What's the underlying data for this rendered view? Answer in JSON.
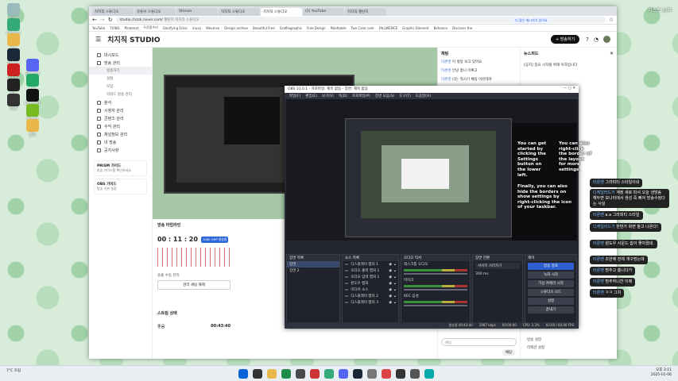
{
  "desktop": {
    "icons": [
      "휴지통",
      "Chrome",
      "폴더",
      "Steam",
      "Adobe",
      "Rix",
      "OBS",
      "Discord",
      "한컴",
      "ChatGPT",
      "Nvidia",
      "폴더"
    ],
    "top_right_text": "지스트 W다"
  },
  "browser": {
    "tabs": [
      "치지직 스튜디오",
      "유튜브 스튜디오",
      "Stream",
      "치지직 스튜디오",
      "치지직 스튜디오",
      "(1) YouTube",
      "치지직 챌린지"
    ],
    "url": "studio.chzzk.naver.com/",
    "url_suffix": "챌린지 치지직 스튜디오",
    "bookmarks": [
      "YouTube",
      "TVING",
      "Pinterest",
      "두루뭉수리",
      "Glorifying Eclec",
      "muxy",
      "Weverse",
      "Design archive",
      "Beautiful Free",
      "Grafilographic",
      "Free Design",
      "Palettable",
      "Two Color com",
      "FALLWENCE",
      "Graphic Element",
      "Behance",
      "Discover the"
    ],
    "logo": "치지직 STUDIO",
    "live_button": "+ 방송하기",
    "sidebar": [
      {
        "label": "대시보드",
        "sub": false
      },
      {
        "label": "방송 관리",
        "sub": false
      },
      {
        "label": "방송하기",
        "sub": true,
        "selected": true
      },
      {
        "label": "설정",
        "sub": true
      },
      {
        "label": "모임",
        "sub": true
      },
      {
        "label": "리워드 방송 관리",
        "sub": true
      },
      {
        "label": "분석",
        "sub": false
      },
      {
        "label": "시청자 관리",
        "sub": false
      },
      {
        "label": "콘텐츠 관리",
        "sub": false
      },
      {
        "label": "수익 관리",
        "sub": false
      },
      {
        "label": "채널정보 관리",
        "sub": false
      },
      {
        "label": "내 방송",
        "sub": false
      },
      {
        "label": "공지사항",
        "sub": false
      }
    ],
    "promo": [
      {
        "title": "PRISM 가이드",
        "desc": "방송 가이드를 확인하세요"
      },
      {
        "title": "OBS 가이드",
        "desc": "방송 기본 설정"
      }
    ],
    "timer_label": "방송 타임라인",
    "timer": "00 : 11 : 20",
    "timer_badge": "1080 DRP 방송중",
    "stream_status_label": "스트림 상태",
    "stream_status_value": "좋음",
    "stream_time": "00:43:40",
    "bitrate_label": "송출 수동 관리",
    "bitrate_button": "관리 세팅 해제",
    "chat_header": "채팅",
    "chat": [
      {
        "name": "타룬멘",
        "text": "이 생방 보고 있어요"
      },
      {
        "name": "타룬멘",
        "text": "안녕 흠니 이쁘고"
      },
      {
        "name": "타룬멘",
        "text": "너는 뭐시기 채팅 이런데야"
      }
    ],
    "news_header": "뉴스피드",
    "news_text": "[공지] 중요 시작될 위해 이하입니다",
    "news_badge": "더 많은 메시지가 있어요",
    "chat_input_label": "채팅",
    "chat_send": "채팅",
    "bottom_notes": [
      "방송 설정",
      "리액션 설정"
    ]
  },
  "obs": {
    "title": "OBS 31.0.1 - 프로파일: 제목 없음 - 장면: 제목 없음",
    "menu": [
      "파일(F)",
      "편집(E)",
      "보기(V)",
      "독(D)",
      "프로파일(P)",
      "장면 모음(S)",
      "도구(T)",
      "도움말(H)"
    ],
    "scene_header": "장면 목록",
    "scenes": [
      "장면",
      "장면 2"
    ],
    "source_header": "소스 목록",
    "sources": [
      "디스플레이 캡처 1",
      "오디오 출력 캡처 1",
      "오디오 입력 캡처 1",
      "윈도우 캡처",
      "미디어 소스",
      "디스플레이 캡처 2",
      "디스플레이 캡처 3"
    ],
    "mixer_header": "오디오 믹서",
    "mixer": [
      "데스크톱 오디오",
      "마이크",
      "REC 음성"
    ],
    "transition_header": "장면 전환",
    "transition_value": "서서히 사라지기",
    "transition_duration": "300 ms",
    "controls_header": "제어",
    "controls": [
      "방송 종료",
      "녹화 시작",
      "가상 카메라 시작",
      "스튜디오 모드",
      "설정",
      "끝내기"
    ],
    "status": [
      "방송중 00:43:40",
      "2987 kbps",
      "00:00:00",
      "CPU: 3.3%",
      "60.00 / 60.00 FPS"
    ]
  },
  "callouts": [
    "You can get started by clicking the Settings button on the lower left.",
    "You can also right-click the border of the layout for more settings.",
    "Finally, you can also hide the borders on show settings by right-clicking the icon of your taskbar."
  ],
  "chat_overlay": [
    {
      "name": "타룬멘",
      "text": "그라피티 스타일이네"
    },
    {
      "name": "디케일러드거",
      "text": "계정 새로 파서 오늘 생방송 해두면 모니터에서 생성 죽 빠져 방송수정다는 사실"
    },
    {
      "name": "타룬멘",
      "text": "a.a 그라피티 스타일"
    },
    {
      "name": "디케일러드거",
      "text": "한번가 화면 돌고 나온다!"
    },
    {
      "name": "타룬멘",
      "text": "윈도우 사운드 쉽이 좋아졌네."
    },
    {
      "name": "타룬멘",
      "text": "조만에 전체 개구멍는데"
    },
    {
      "name": "타룬멘",
      "text": "멈추고 흠니다가"
    },
    {
      "name": "타룬멘",
      "text": "멈추하니깐 이제"
    },
    {
      "name": "타룬멘",
      "text": "ㅋㅋ 그치"
    }
  ],
  "taskbar": {
    "weather": "7°C 흐림",
    "time": "오후 3:11",
    "date": "2025-01-06"
  }
}
